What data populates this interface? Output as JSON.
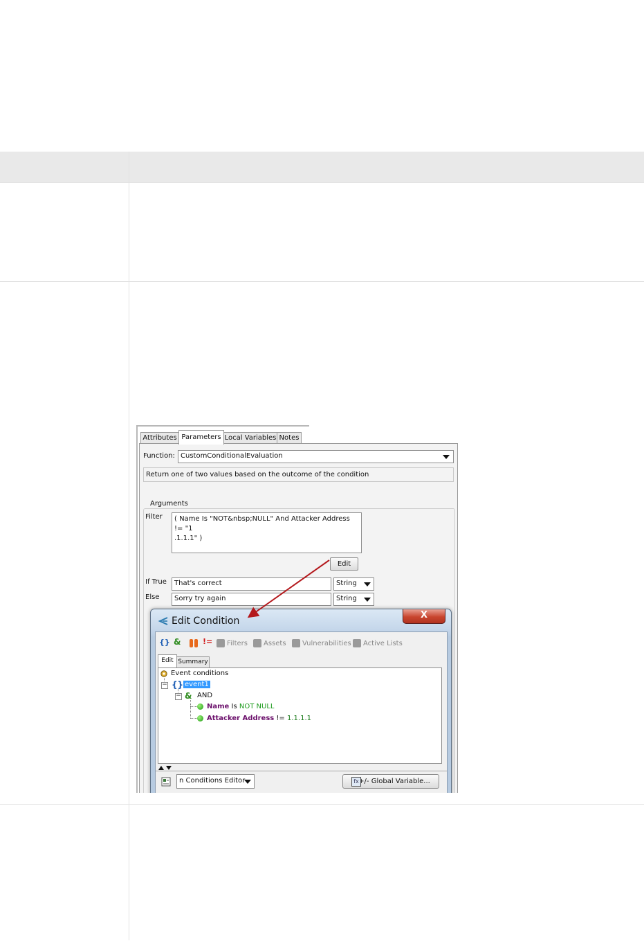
{
  "figure": {
    "tabs": [
      "Attributes",
      "Parameters",
      "Local Variables",
      "Notes"
    ],
    "function_label": "Function:",
    "function_value": "CustomConditionalEvaluation",
    "description": "Return one of two values based on the outcome of the condition",
    "arguments_title": "Arguments",
    "filter_label": "Filter",
    "filter_value_line1": "( Name Is \"NOT&nbsp;NULL\" And Attacker Address != \"1",
    "filter_value_line2": ".1.1.1\" )",
    "edit_button": "Edit",
    "if_true_label": "If True",
    "if_true_value": "That's correct",
    "if_true_type": "String",
    "else_label": "Else",
    "else_value": "Sorry try again",
    "else_type": "String",
    "dialog": {
      "title": "Edit Condition",
      "close": "X",
      "toolbar": [
        "Filters",
        "Assets",
        "Vulnerabilities",
        "Active Lists"
      ],
      "tabs": [
        "Edit",
        "Summary"
      ],
      "tree": {
        "root": "Event conditions",
        "event": "event1",
        "operator": "AND",
        "cond1_field": "Name",
        "cond1_op": "Is",
        "cond1_value": "NOT NULL",
        "cond2_field": "Attacker Address",
        "cond2_op": "!=",
        "cond2_value": "1.1.1.1"
      },
      "editor_select": "n Conditions Editor",
      "global_variable_button": "+/- Global Variable..."
    }
  },
  "colors": {
    "accent_arrow": "#b4191d",
    "selection": "#3399ff",
    "field_name": "#6b0f6b",
    "value_green": "#1a7a1a"
  }
}
